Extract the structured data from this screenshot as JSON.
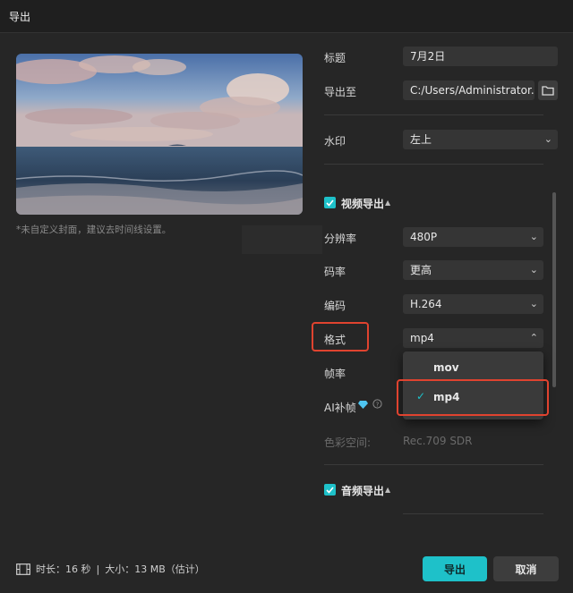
{
  "window": {
    "title": "导出"
  },
  "preview": {
    "hint": "*未自定义封面，建议去时间线设置。"
  },
  "form": {
    "title_label": "标题",
    "title_value": "7月2日",
    "export_to_label": "导出至",
    "export_to_value": "C:/Users/Administrator...",
    "watermark_label": "水印",
    "watermark_value": "左上"
  },
  "video": {
    "section_label": "视频导出",
    "resolution_label": "分辨率",
    "resolution_value": "480P",
    "bitrate_label": "码率",
    "bitrate_value": "更高",
    "codec_label": "编码",
    "codec_value": "H.264",
    "format_label": "格式",
    "format_value": "mp4",
    "format_options": [
      "mov",
      "mp4"
    ],
    "framerate_label": "帧率",
    "ai_frame_label": "AI补帧",
    "color_space_label": "色彩空间:",
    "color_space_value": "Rec.709 SDR"
  },
  "audio": {
    "section_label": "音频导出"
  },
  "footer": {
    "duration_label": "时长：",
    "duration_value": "16 秒",
    "divider": "|",
    "size_label": "大小：",
    "size_value": "13 MB（估计）",
    "export_button": "导出",
    "cancel_button": "取消"
  },
  "colors": {
    "accent": "#1ec1c9",
    "highlight": "#e0432f",
    "background": "#262626"
  },
  "icons": [
    "folder-icon",
    "chevron-down-icon",
    "chevron-up-icon",
    "checkbox-checked-icon",
    "diamond-icon",
    "info-icon",
    "film-icon",
    "check-icon"
  ]
}
